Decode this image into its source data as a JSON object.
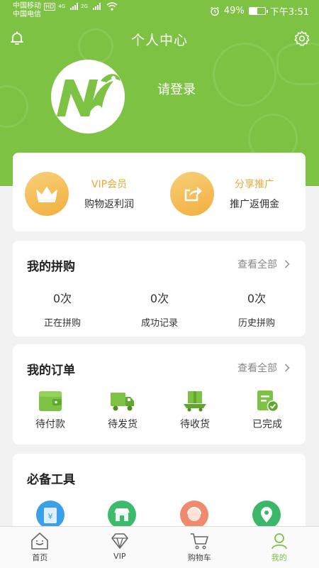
{
  "status_bar": {
    "carrier1": "中国移动",
    "carrier1_badge": "HD",
    "net1": "4G",
    "carrier2": "中国电信",
    "net2": "2G",
    "battery": "49%",
    "time": "下午3:51"
  },
  "header": {
    "title": "个人中心",
    "login_prompt": "请登录"
  },
  "vip_card": {
    "vip": {
      "title": "VIP会员",
      "subtitle": "购物返利润"
    },
    "share": {
      "title": "分享推广",
      "subtitle": "推广返佣金"
    }
  },
  "group_buy": {
    "title": "我的拼购",
    "view_all": "查看全部",
    "stats": [
      {
        "value": "0次",
        "label": "正在拼购"
      },
      {
        "value": "0次",
        "label": "成功记录"
      },
      {
        "value": "0次",
        "label": "历史拼购"
      }
    ]
  },
  "orders": {
    "title": "我的订单",
    "view_all": "查看全部",
    "items": [
      {
        "label": "待付款",
        "icon": "wallet-icon"
      },
      {
        "label": "待发货",
        "icon": "truck-icon"
      },
      {
        "label": "待收货",
        "icon": "package-icon"
      },
      {
        "label": "已完成",
        "icon": "completed-doc-icon"
      }
    ]
  },
  "tools": {
    "title": "必备工具",
    "items": [
      {
        "icon": "yuan-card-icon",
        "color": "#3aa0e8"
      },
      {
        "icon": "store-icon",
        "color": "#3dbb6d"
      },
      {
        "icon": "customer-service-icon",
        "color": "#f08a6e"
      },
      {
        "icon": "location-icon",
        "color": "#3cb768"
      }
    ]
  },
  "tabbar": {
    "items": [
      {
        "label": "首页",
        "icon": "home-icon",
        "active": false
      },
      {
        "label": "VIP",
        "icon": "diamond-icon",
        "active": false
      },
      {
        "label": "购物车",
        "icon": "cart-icon",
        "active": false
      },
      {
        "label": "我的",
        "icon": "profile-icon",
        "active": true
      }
    ]
  },
  "colors": {
    "brand_green": "#7dc242",
    "vip_orange": "#f0a732",
    "background": "#f2f2f2"
  }
}
